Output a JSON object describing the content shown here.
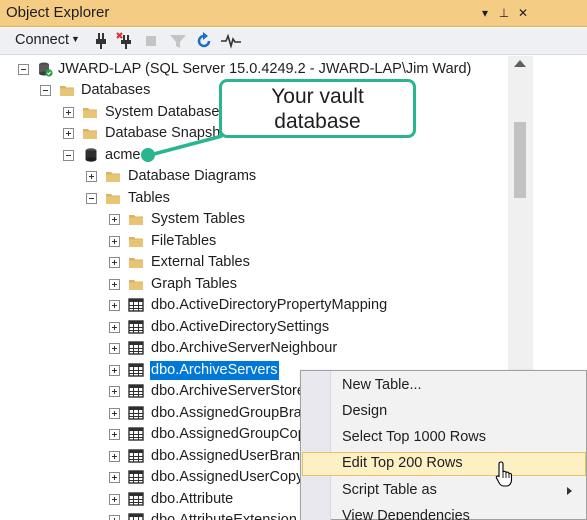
{
  "panel": {
    "title": "Object Explorer",
    "window_buttons": [
      "▾",
      "⊥",
      "✕"
    ]
  },
  "toolbar": {
    "connect_label": "Connect",
    "tools": [
      "connect-icon",
      "disconnect-icon",
      "stop-icon",
      "filter-icon",
      "refresh-icon",
      "activity-monitor-icon"
    ]
  },
  "tree": {
    "server": "JWARD-LAP (SQL Server 15.0.4249.2 - JWARD-LAP\\Jim Ward)",
    "databases": "Databases",
    "system_databases": "System Databases",
    "database_snapshots": "Database Snapshots",
    "acme": "acme",
    "database_diagrams": "Database Diagrams",
    "tables": "Tables",
    "system_tables": "System Tables",
    "file_tables": "FileTables",
    "external_tables": "External Tables",
    "graph_tables": "Graph Tables",
    "table_items": [
      "dbo.ActiveDirectoryPropertyMapping",
      "dbo.ActiveDirectorySettings",
      "dbo.ArchiveServerNeighbour",
      "dbo.ArchiveServers",
      "dbo.ArchiveServerStore",
      "dbo.AssignedGroupBra",
      "dbo.AssignedGroupCop",
      "dbo.AssignedUserBranc",
      "dbo.AssignedUserCopy",
      "dbo.Attribute",
      "dbo.AttributeExtension"
    ]
  },
  "context_menu": {
    "items": [
      "New Table...",
      "Design",
      "Select Top 1000 Rows",
      "Edit Top 200 Rows",
      "Script Table as",
      "View Dependencies"
    ],
    "highlighted": "Edit Top 200 Rows"
  },
  "callout": {
    "line1": "Your vault",
    "line2": "database"
  },
  "colors": {
    "title_bar": "#f5cc84",
    "selection": "#0078d7",
    "callout_border": "#2ab591",
    "folder": "#dcb35c",
    "menu_highlight": "#fcf1c5"
  }
}
